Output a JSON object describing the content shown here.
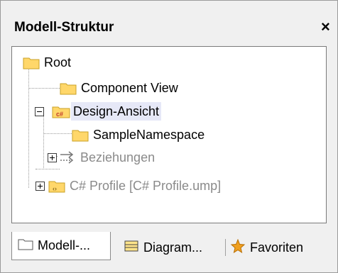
{
  "panel": {
    "title": "Modell-Struktur",
    "close_glyph": "×"
  },
  "tree": {
    "root": "Root",
    "component_view": "Component View",
    "design_ansicht": "Design-Ansicht",
    "sample_namespace": "SampleNamespace",
    "beziehungen": "Beziehungen",
    "cs_profile": "C# Profile [C# Profile.ump]"
  },
  "tabs": [
    {
      "label": "Modell-...",
      "icon": "folder-icon",
      "active": true
    },
    {
      "label": "Diagram...",
      "icon": "diagram-tree-icon",
      "active": false
    },
    {
      "label": "Favoriten",
      "icon": "favorites-star-icon",
      "active": false
    }
  ],
  "colors": {
    "folder_fill": "#ffd76a",
    "folder_border": "#c9a227",
    "selection": "#e6e8f7",
    "dim_text": "#8a8a8a"
  }
}
